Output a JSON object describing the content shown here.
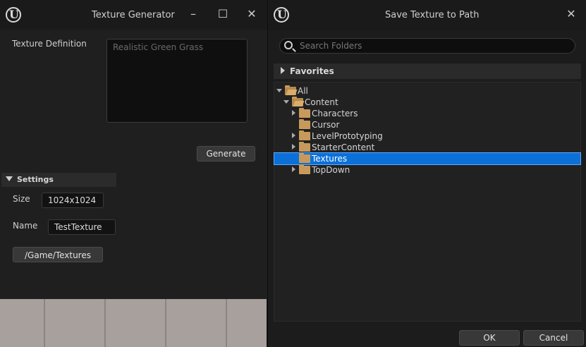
{
  "left_window": {
    "title": "Texture Generator",
    "minimize_icon": "minimize-icon",
    "maximize_icon": "maximize-icon",
    "close_icon": "close-icon",
    "texture_definition_label": "Texture Definition",
    "texture_definition_placeholder": "Realistic Green Grass",
    "generate_label": "Generate",
    "settings_header": "Settings",
    "size_label": "Size",
    "size_value": "1024x1024",
    "name_label": "Name",
    "name_value": "TestTexture",
    "path_button_label": "/Game/Textures"
  },
  "right_window": {
    "title": "Save Texture to Path",
    "search_placeholder": "Search Folders",
    "favorites_label": "Favorites",
    "tree": [
      {
        "label": "All",
        "expanded": true,
        "selected": false
      },
      {
        "label": "Content",
        "expanded": true,
        "selected": false
      },
      {
        "label": "Characters",
        "expanded": false,
        "selected": false
      },
      {
        "label": "Cursor",
        "expanded": false,
        "selected": false
      },
      {
        "label": "LevelPrototyping",
        "expanded": false,
        "selected": false
      },
      {
        "label": "StarterContent",
        "expanded": false,
        "selected": false
      },
      {
        "label": "Textures",
        "expanded": false,
        "selected": true
      },
      {
        "label": "TopDown",
        "expanded": false,
        "selected": false
      }
    ],
    "ok_label": "OK",
    "cancel_label": "Cancel"
  },
  "colors": {
    "selection": "#0b70d8",
    "folder": "#c79a5c"
  }
}
